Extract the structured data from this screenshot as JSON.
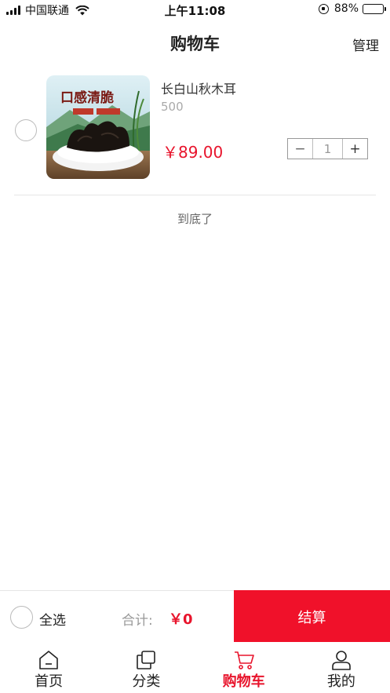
{
  "status_bar": {
    "carrier": "中国联通",
    "time": "上午11:08",
    "battery": "88%",
    "battery_level": 0.88
  },
  "header": {
    "title": "购物车",
    "manage_label": "管理"
  },
  "cart": {
    "items": [
      {
        "name": "长白山秋木耳",
        "spec": "500",
        "price": "￥89.00",
        "quantity": "1",
        "thumb_text": "口感清脆"
      }
    ],
    "end_tip": "到底了"
  },
  "checkout": {
    "select_all_label": "全选",
    "total_label": "合计:",
    "total_value": "￥0",
    "button_label": "结算"
  },
  "tabs": [
    {
      "label": "首页",
      "icon": "home-icon"
    },
    {
      "label": "分类",
      "icon": "category-icon"
    },
    {
      "label": "购物车",
      "icon": "cart-icon",
      "active": true
    },
    {
      "label": "我的",
      "icon": "profile-icon"
    }
  ],
  "colors": {
    "accent": "#e8142c",
    "checkout_button": "#f0112a"
  }
}
